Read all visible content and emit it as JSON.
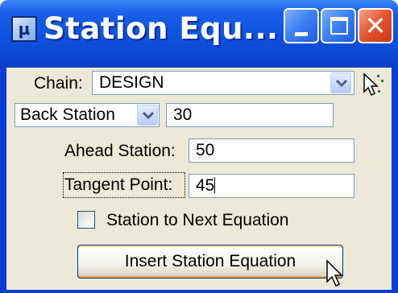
{
  "window": {
    "title": "Station Equ...",
    "app_icon_glyph": "µ",
    "close_glyph": "✕"
  },
  "chain": {
    "label": "Chain:",
    "value": "DESIGN"
  },
  "station_mode": {
    "selected": "Back Station",
    "value": "30"
  },
  "ahead_station": {
    "label": "Ahead Station:",
    "value": "50"
  },
  "tangent_point": {
    "label": "Tangent Point:",
    "value": "45"
  },
  "next_equation": {
    "label": "Station to Next Equation",
    "checked": false
  },
  "insert_button": {
    "label": "Insert Station Equation"
  },
  "icons": {
    "app": "microstation-app-icon",
    "pick": "pick-element-cursor-icon",
    "pointer": "mouse-pointer-icon"
  },
  "colors": {
    "title_bar": "#0f54e0",
    "client_bg": "#ece9d8",
    "close_button": "#e2542f",
    "field_border": "#7f9db9"
  }
}
